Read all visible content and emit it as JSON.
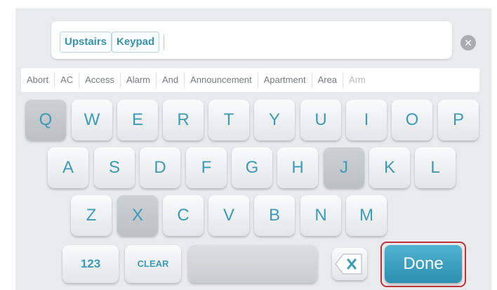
{
  "entry": {
    "chips": [
      "Upstairs",
      "Keypad"
    ],
    "clear_icon": "close-circle-icon"
  },
  "suggestions": [
    "Abort",
    "AC",
    "Access",
    "Alarm",
    "And",
    "Announcement",
    "Apartment",
    "Area",
    "Arm"
  ],
  "keys": {
    "row1": [
      "Q",
      "W",
      "E",
      "R",
      "T",
      "Y",
      "U",
      "I",
      "O",
      "P"
    ],
    "row2": [
      "A",
      "S",
      "D",
      "F",
      "G",
      "H",
      "J",
      "K",
      "L"
    ],
    "row3": [
      "Z",
      "X",
      "C",
      "V",
      "B",
      "N",
      "M"
    ],
    "pressed": [
      "Q",
      "J",
      "X"
    ]
  },
  "function_keys": {
    "numbers": "123",
    "clear": "CLEAR",
    "backspace_icon": "backspace-icon",
    "done": "Done"
  },
  "colors": {
    "accent": "#3d9bb8",
    "done_button": "#3a9fc0",
    "highlight_outline": "#c0313a",
    "background": "#e9eaec"
  }
}
